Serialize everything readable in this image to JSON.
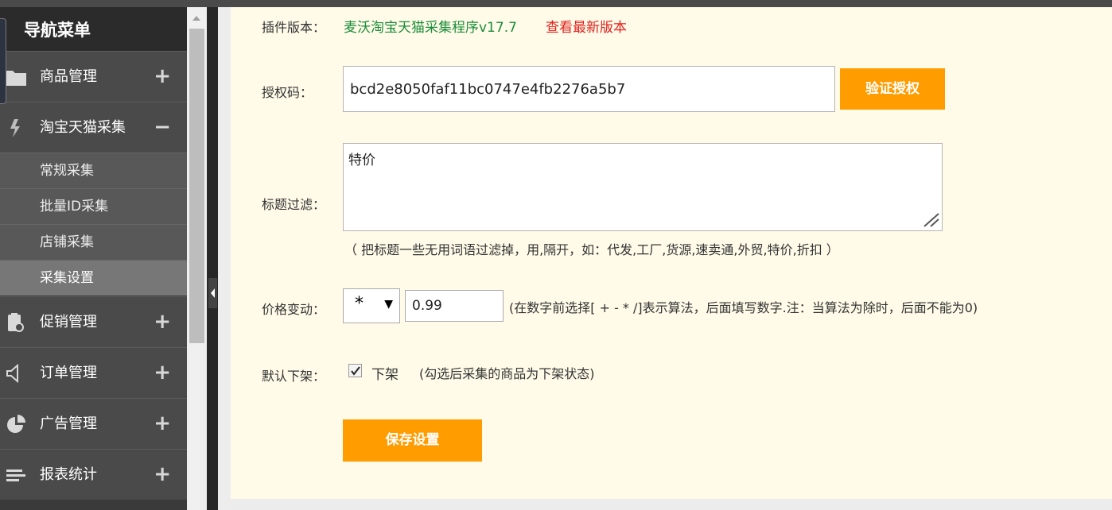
{
  "sidebar": {
    "title": "导航菜单",
    "sections": [
      {
        "label": "商品管理",
        "toggle": "+",
        "icon": "folder-icon"
      },
      {
        "label": "淘宝天猫采集",
        "toggle": "−",
        "icon": "lightning-icon"
      },
      {
        "label": "促销管理",
        "toggle": "+",
        "icon": "clipboard-icon"
      },
      {
        "label": "订单管理",
        "toggle": "+",
        "icon": "speaker-icon"
      },
      {
        "label": "广告管理",
        "toggle": "+",
        "icon": "pie-chart-icon"
      },
      {
        "label": "报表统计",
        "toggle": "+",
        "icon": "lines-icon"
      }
    ],
    "sub_items": [
      {
        "label": "常规采集"
      },
      {
        "label": "批量ID采集"
      },
      {
        "label": "店铺采集"
      },
      {
        "label": "采集设置"
      }
    ],
    "active_sub_item": "采集设置"
  },
  "form": {
    "version": {
      "label": "插件版本：",
      "value": "麦沃淘宝天猫采集程序v17.7",
      "link": "查看最新版本"
    },
    "auth": {
      "label": "授权码：",
      "value": "bcd2e8050faf11bc0747e4fb2276a5b7",
      "button": "验证授权"
    },
    "title_filter": {
      "label": "标题过滤：",
      "value": "特价",
      "hint": "（ 把标题一些无用词语过滤掉，用,隔开，如：代发,工厂,货源,速卖通,外贸,特价,折扣 ）"
    },
    "price": {
      "label": "价格变动：",
      "operator": "*",
      "operator_arrow": "▼",
      "value": "0.99",
      "hint": "(在数字前选择[ + - * /]表示算法，后面填写数字.注：当算法为除时，后面不能为0)"
    },
    "default_off": {
      "label": "默认下架：",
      "checkbox_label": "下架",
      "checked": true,
      "hint": "(勾选后采集的商品为下架状态)"
    },
    "save_button": "保存设置"
  },
  "colors": {
    "accent": "#ff9c00",
    "version_green": "#1b8d3a",
    "link_red": "#e0201e",
    "content_bg": "#fffbe8"
  }
}
